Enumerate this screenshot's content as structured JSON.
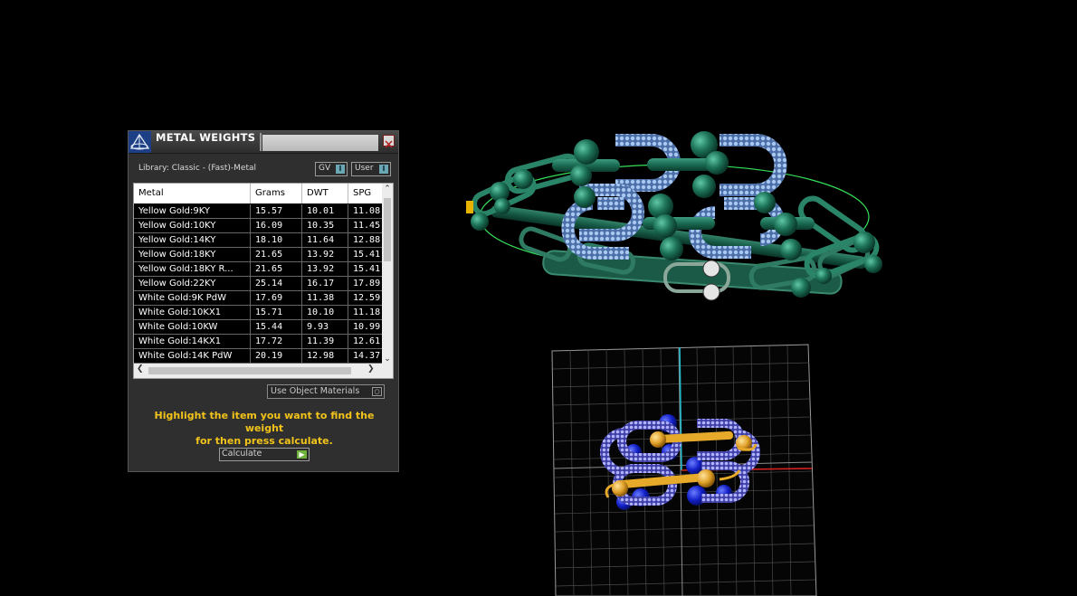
{
  "panel": {
    "title": "METAL WEIGHTS",
    "library_label": "Library: Classic - (Fast)-Metal",
    "gv_toggle": "GV",
    "user_toggle": "User",
    "toggle_glyph": "I",
    "columns": [
      "Metal",
      "Grams",
      "DWT",
      "SPG"
    ],
    "rows": [
      [
        "Yellow Gold:9KY",
        "15.57",
        "10.01",
        "11.08"
      ],
      [
        "Yellow Gold:10KY",
        "16.09",
        "10.35",
        "11.45"
      ],
      [
        "Yellow Gold:14KY",
        "18.10",
        "11.64",
        "12.88"
      ],
      [
        "Yellow Gold:18KY",
        "21.65",
        "13.92",
        "15.41"
      ],
      [
        "Yellow Gold:18KY R...",
        "21.65",
        "13.92",
        "15.41"
      ],
      [
        "Yellow Gold:22KY",
        "25.14",
        "16.17",
        "17.89"
      ],
      [
        "White Gold:9K PdW",
        "17.69",
        "11.38",
        "12.59"
      ],
      [
        "White Gold:10KX1",
        "15.71",
        "10.10",
        "11.18"
      ],
      [
        "White Gold:10KW",
        "15.44",
        "9.93",
        "10.99"
      ],
      [
        "White Gold:14KX1",
        "17.72",
        "11.39",
        "12.61"
      ],
      [
        "White Gold:14K PdW",
        "20.19",
        "12.98",
        "14.37"
      ]
    ],
    "materials_dropdown": "Use Object Materials",
    "hint_line1": "Highlight the item you want to find the weight",
    "hint_line2": "for then press calculate.",
    "calculate_label": "Calculate",
    "icons": {
      "logo": "rhino-logo-icon",
      "close": "close-icon",
      "scroll_up": "chevron-up-icon",
      "scroll_down": "chevron-down-icon",
      "scroll_left": "chevron-left-icon",
      "scroll_right": "chevron-right-icon",
      "play": "play-icon"
    }
  },
  "viewport": {
    "colors": {
      "background": "#000000",
      "ring_metal": "#1f6b57",
      "chain_links": "#8fb6e6",
      "gold_parts": "#e6a92a",
      "blue_parts": "#1b2ed6",
      "grid": "#8a8a8a"
    }
  }
}
